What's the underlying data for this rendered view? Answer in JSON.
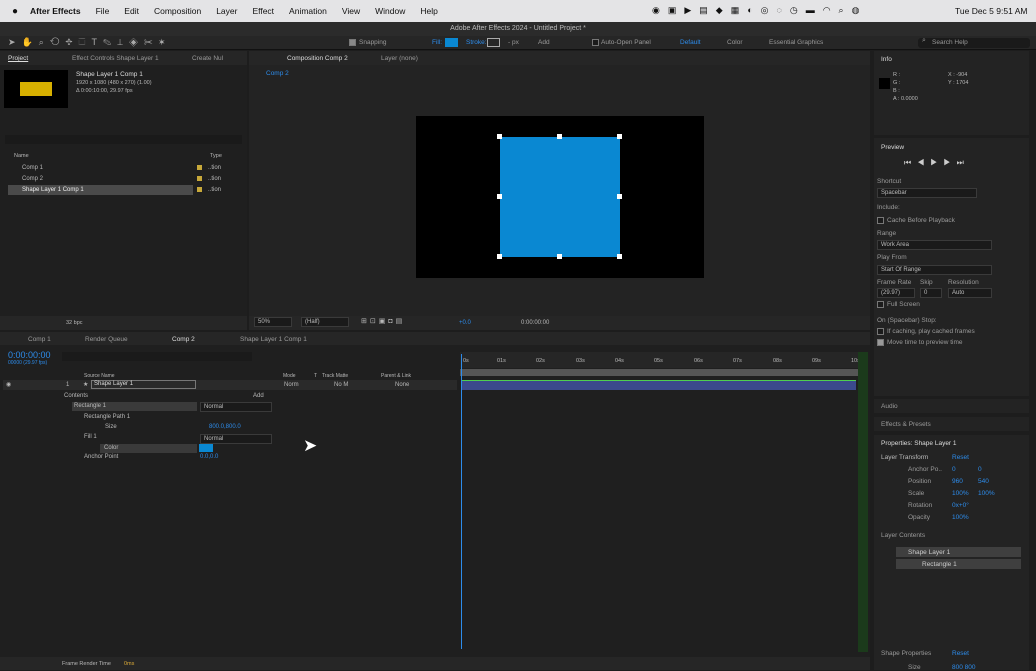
{
  "menubar": {
    "app": "After Effects",
    "items": [
      "File",
      "Edit",
      "Composition",
      "Layer",
      "Effect",
      "Animation",
      "View",
      "Window",
      "Help"
    ],
    "datetime": "Tue Dec 5  9:51 AM"
  },
  "window_title": "Adobe After Effects 2024 - Untitled Project *",
  "toolbar": {
    "snapping": "Snapping",
    "fill": "Fill:",
    "stroke": "Stroke:",
    "stroke_px": "- px",
    "add": "Add",
    "auto_open": "Auto-Open Panel",
    "workspaces": [
      "Default",
      "Color",
      "Essential Graphics"
    ],
    "search_placeholder": "Search Help"
  },
  "project": {
    "tab": "Project",
    "effect_controls": "Effect Controls Shape Layer 1",
    "create_null": "Create Nul",
    "item_name": "Shape Layer 1 Comp 1",
    "item_size": "1920 x 1080  (480 x 270) (1.00)",
    "item_dur": "Δ 0:00:10:00, 29.97 fps",
    "col_name": "Name",
    "col_type": "Type",
    "items": [
      {
        "name": "Comp 1",
        "type": "..tion"
      },
      {
        "name": "Comp 2",
        "type": "..tion"
      },
      {
        "name": "Shape Layer 1 Comp 1",
        "type": "..tion"
      }
    ],
    "bpc": "32 bpc"
  },
  "comp": {
    "tab": "Composition Comp 2",
    "layer_tab": "Layer (none)",
    "sub": "Comp 2",
    "zoom": "50%",
    "quality": "(Half)",
    "exposure": "+0.0",
    "time": "0:00:00:00",
    "square_color": "#0a88d2"
  },
  "info": {
    "title": "Info",
    "rgb": [
      "R :",
      "G :",
      "B :"
    ],
    "a": "A : 0.0000",
    "x": "X : -904",
    "y": "Y : 1704"
  },
  "preview": {
    "title": "Preview",
    "shortcut_label": "Shortcut",
    "shortcut": "Spacebar",
    "include": "Include:",
    "cache": "Cache Before Playback",
    "range_label": "Range",
    "range": "Work Area",
    "playfrom_label": "Play From",
    "playfrom": "Start Of Range",
    "fr_label": "Frame Rate",
    "skip_label": "Skip",
    "res_label": "Resolution",
    "fr": "(29.97)",
    "skip": "0",
    "res": "Auto",
    "fullscreen": "Full Screen",
    "stop_label": "On (Spacebar) Stop:",
    "if_caching": "If caching, play cached frames",
    "move_time": "Move time to preview time"
  },
  "right": {
    "audio": "Audio",
    "effects": "Effects & Presets",
    "props_title": "Properties: Shape Layer 1",
    "layer_transform": "Layer Transform",
    "reset": "Reset",
    "transform": [
      {
        "name": "Anchor Po..",
        "v1": "0",
        "v2": "0"
      },
      {
        "name": "Position",
        "v1": "960",
        "v2": "540"
      },
      {
        "name": "Scale",
        "v1": "100%",
        "v2": "100%"
      },
      {
        "name": "Rotation",
        "v1": "0x+0°",
        "v2": ""
      },
      {
        "name": "Opacity",
        "v1": "100%",
        "v2": ""
      }
    ],
    "layer_contents": "Layer Contents",
    "contents": [
      "Shape Layer 1",
      "Rectangle 1"
    ],
    "shape_props": "Shape Properties",
    "size_label": "Size",
    "size_v": "800   800"
  },
  "timeline": {
    "tabs": [
      "Comp 1",
      "Render Queue",
      "Comp 2",
      "Shape Layer 1 Comp 1"
    ],
    "timecode": "0:00:00:00",
    "fps": "00000 (29.97 fps)",
    "col_source": "Source Name",
    "col_mode": "Mode",
    "col_t": "T",
    "col_trackmatte": "Track Matte",
    "col_parent": "Parent & Link",
    "layer_num": "1",
    "layer_name": "Shape Layer 1",
    "layer_mode": "Norm",
    "layer_matte": "No M",
    "layer_parent": "None",
    "contents": "Contents",
    "add": "Add",
    "rect": "Rectangle 1",
    "rect_mode": "Normal",
    "rect_path": "Rectangle Path 1",
    "size": "Size",
    "size_val": "800.0,800.0",
    "fill": "Fill 1",
    "fill_mode": "Normal",
    "color": "Color",
    "anchor": "Anchor Point",
    "anchor_val": "0.0,0.0",
    "ruler": [
      "0s",
      "01s",
      "02s",
      "03s",
      "04s",
      "05s",
      "06s",
      "07s",
      "08s",
      "09s",
      "10s"
    ],
    "render_time_label": "Frame Render Time",
    "render_time": "0ms"
  }
}
